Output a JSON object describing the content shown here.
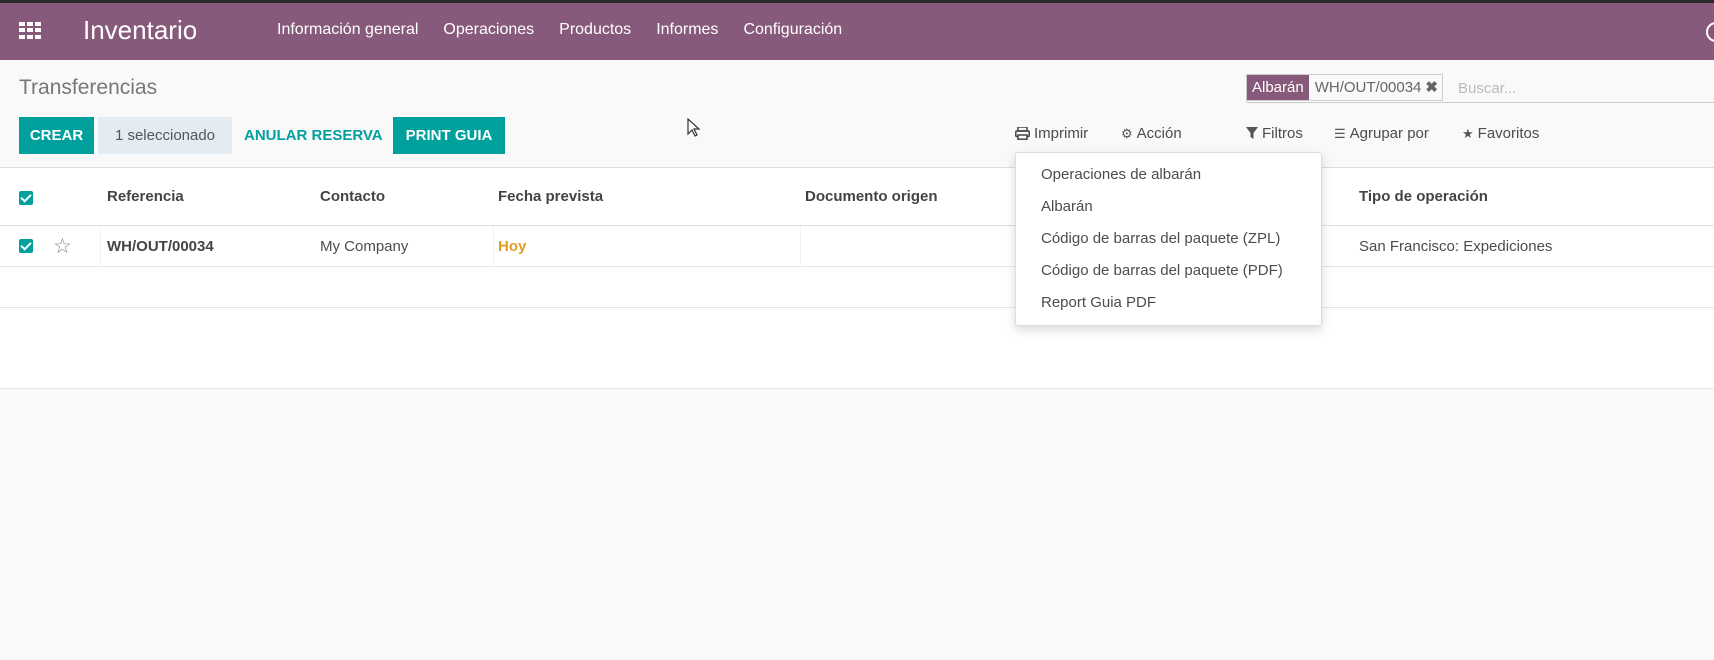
{
  "topbar": {
    "app_title": "Inventario",
    "menu": [
      "Información general",
      "Operaciones",
      "Productos",
      "Informes",
      "Configuración"
    ]
  },
  "breadcrumb": "Transferencias",
  "search": {
    "facet_label": "Albarán",
    "facet_value": "WH/OUT/00034",
    "facet_remove": "✖",
    "placeholder": "Buscar..."
  },
  "toolbar": {
    "create_label": "CREAR",
    "selected_label": "1 seleccionado",
    "unreserve_label": "ANULAR RESERVA",
    "print_guia_label": "PRINT GUIA",
    "print_label": "Imprimir",
    "action_label": "Acción",
    "filters_label": "Filtros",
    "groupby_label": "Agrupar por",
    "favorites_label": "Favoritos"
  },
  "table": {
    "columns": [
      "Referencia",
      "Contacto",
      "Fecha prevista",
      "Documento origen",
      "Tipo de operación"
    ],
    "rows": [
      {
        "reference": "WH/OUT/00034",
        "contact": "My Company",
        "scheduled": "Hoy",
        "origin": "",
        "operation_type": "San Francisco: Expediciones",
        "selected": true
      }
    ]
  },
  "print_menu": {
    "items": [
      "Operaciones de albarán",
      "Albarán",
      "Código de barras del paquete (ZPL)",
      "Código de barras del paquete (PDF)",
      "Report Guia PDF"
    ]
  },
  "colors": {
    "brand": "#875a7b",
    "accent": "#00a09d",
    "date_highlight": "#e69c20"
  },
  "icons": {
    "apps": "apps-grid-icon",
    "print": "printer-icon",
    "action": "gear-icon",
    "filter": "filter-icon",
    "groupby": "bars-icon",
    "favorites": "star-icon"
  }
}
